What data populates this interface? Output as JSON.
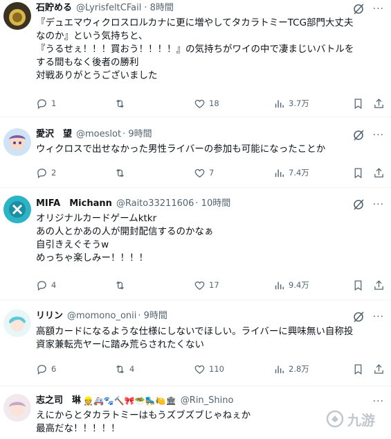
{
  "tweets": [
    {
      "name": "石貯める",
      "handle": "@LyrisfeltCFail",
      "time": "· 8時間",
      "lines": [
        "『デュエマウィクロスロルカナに更に増やしてタカラトミーTCG部門大丈夫",
        "なのか』という気持ちと、",
        "『うるせぇ！！！買おう！！！！』の気持ちがワイの中で凄まじいバトルを",
        "する間もなく後者の勝利",
        "対戦ありがとうございました"
      ],
      "replies": "1",
      "reposts": "",
      "likes": "18",
      "views": "3.7万"
    },
    {
      "name": "愛沢　望",
      "handle": "@moeslot",
      "time": "· 9時間",
      "lines": [
        "ウィクロスで出せなかった男性ライバーの参加も可能になったことか"
      ],
      "replies": "2",
      "reposts": "",
      "likes": "7",
      "views": "7.4万"
    },
    {
      "name": "MIFA　Michann",
      "handle": "@Raito33211606",
      "time": "· 10時間",
      "lines": [
        "オリジナルカードゲームktkr",
        "あの人とかあの人が開封配信するのかなぁ",
        "自引きえぐそうw",
        "めっちゃ楽しみー！！！！"
      ],
      "replies": "4",
      "reposts": "",
      "likes": "17",
      "views": "9.4万"
    },
    {
      "name": "リリン",
      "handle": "@momono_onii",
      "time": "· 9時間",
      "lines": [
        "高額カードになるような仕様にしないでほしい。ライバーに興味無い自称投",
        "資家兼転売ヤーに踏み荒らされたくない"
      ],
      "replies": "6",
      "reposts": "4",
      "likes": "110",
      "views": "2.8万"
    },
    {
      "name": "志之司　琳",
      "emoji": "👷🚑🐾🔨🎀🥗🛼🍋🏛",
      "handle": "@Rin_Shino",
      "time": "",
      "lines": [
        "えにからとタカラトミーはもうズブズブじゃねぇか",
        "最高だな！！！！！"
      ]
    }
  ],
  "watermark": "九游",
  "colors": {
    "text": "#0f1419",
    "muted": "#536471",
    "divider": "#eff3f4"
  }
}
